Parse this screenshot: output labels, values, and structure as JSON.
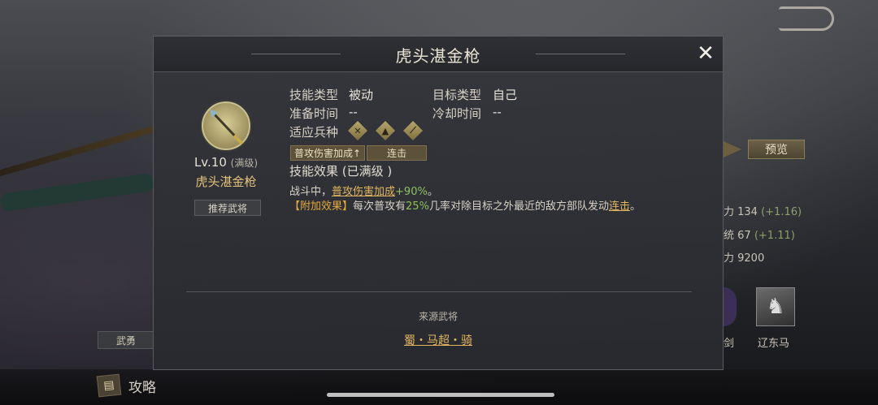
{
  "background": {
    "preview_label": "预览",
    "stats": [
      {
        "label": "力 134",
        "bonus": "(+1.16)"
      },
      {
        "label": "统 67",
        "bonus": "(+1.11)"
      },
      {
        "label": "力 9200",
        "bonus": ""
      }
    ],
    "equip_slot_1_label": "剑",
    "equip_slot_2_label": "辽东马",
    "trait_tag": "武勇",
    "guide_label": "攻略"
  },
  "modal": {
    "title": "虎头湛金枪",
    "skill": {
      "level": "Lv.10",
      "level_note": "(满级)",
      "name": "虎头湛金枪",
      "recommend_label": "推荐武将"
    },
    "info": {
      "skill_type_label": "技能类型",
      "skill_type_value": "被动",
      "target_type_label": "目标类型",
      "target_type_value": "自己",
      "prep_time_label": "准备时间",
      "prep_time_value": "--",
      "cooldown_label": "冷却时间",
      "cooldown_value": "--",
      "troop_label": "适应兵种"
    },
    "troop_icons": [
      "spear-troop-icon",
      "cavalry-troop-icon",
      "archer-troop-icon"
    ],
    "tags": [
      "普攻伤害加成↑",
      "连击"
    ],
    "effect": {
      "title": "技能效果 (已满级 )",
      "line1_prefix": "战斗中，",
      "line1_link": "普攻伤害加成",
      "line1_value": "+90%",
      "line1_suffix": "。",
      "line2_bracket": "【附加效果】",
      "line2_text_a": "每次普攻有",
      "line2_value": "25%",
      "line2_text_b": "几率对除目标之外最近的敌方部队发动",
      "line2_link": "连击",
      "line2_end": "。"
    },
    "source": {
      "label": "来源武将",
      "hero": "蜀・马超・骑"
    }
  },
  "colors": {
    "gold_link": "#e2b660",
    "green_value": "#8cc15b",
    "bracket": "#e3a93a"
  }
}
